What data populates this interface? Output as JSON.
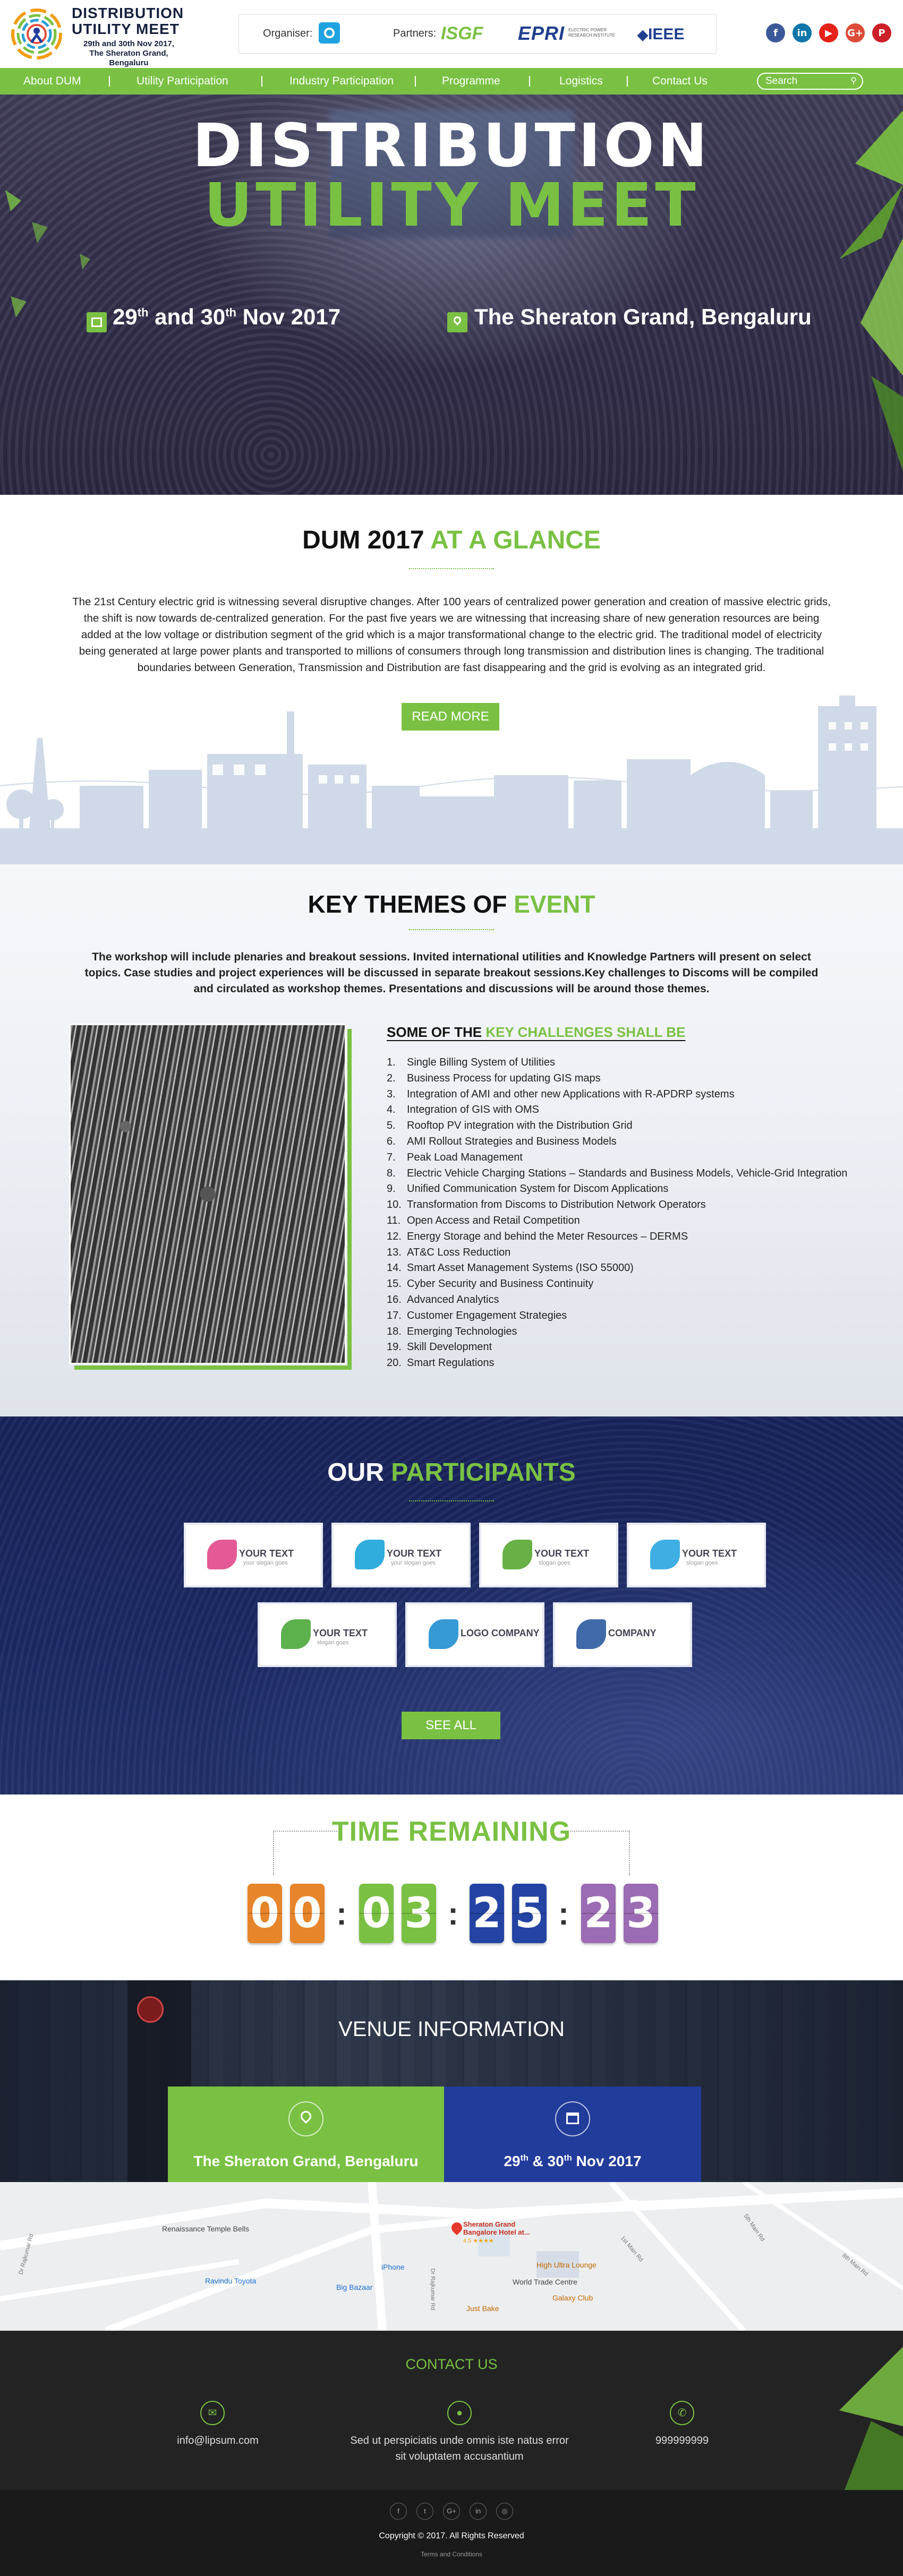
{
  "header": {
    "logo_title_1": "DISTRIBUTION",
    "logo_title_2": "UTILITY MEET",
    "logo_sub_1": "29th and 30th Nov 2017,",
    "logo_sub_2": "The Sheraton Grand, Bengaluru",
    "organiser_label": "Organiser:",
    "partners_label": "Partners:",
    "partner_isgf": "ISGF",
    "partner_epri": "EPRI",
    "partner_epri_sub": "ELECTRIC POWER RESEARCH INSTITUTE",
    "partner_ieee": "IEEE",
    "social": [
      {
        "name": "facebook-icon",
        "glyph": "f",
        "color": "#3b5998"
      },
      {
        "name": "linkedin-icon",
        "glyph": "in",
        "color": "#0e76a8"
      },
      {
        "name": "youtube-icon",
        "glyph": "▶",
        "color": "#e62117"
      },
      {
        "name": "googleplus-icon",
        "glyph": "G+",
        "color": "#dd4b39"
      },
      {
        "name": "pinterest-icon",
        "glyph": "P",
        "color": "#cb2027"
      }
    ]
  },
  "nav": {
    "items": [
      "About DUM",
      "Utility Participation",
      "Industry Participation",
      "Programme",
      "Logistics",
      "Contact Us"
    ],
    "search_placeholder": "Search"
  },
  "hero": {
    "title_1": "DISTRIBUTION",
    "title_2": "UTILITY MEET",
    "date_day1": "29",
    "date_sup1": "th",
    "date_and": " and 30",
    "date_sup2": "th",
    "date_tail": " Nov 2017",
    "venue": "The Sheraton Grand, Bengaluru"
  },
  "glance": {
    "title_a": "DUM 2017 ",
    "title_b": "AT A GLANCE",
    "paragraph": "The 21st Century electric grid is witnessing several disruptive changes. After 100 years of centralized power generation and creation of massive electric grids, the shift is now towards de-centralized generation. For the past five years we are witnessing that increasing share of new generation resources are being added at the low voltage or distribution segment of the grid which is a major transformational change to the electric grid. The traditional model of electricity being generated at large power plants and transported to millions of consumers through long transmission and distribution lines is changing. The traditional boundaries between Generation, Transmission and Distribution are fast disappearing and the grid is evolving as an integrated grid.",
    "button": "READ MORE"
  },
  "themes": {
    "title_a": "KEY THEMES OF ",
    "title_b": "EVENT",
    "paragraph": "The workshop will include plenaries and breakout sessions. Invited international utilities and Knowledge Partners will present on select topics. Case studies and project experiences will be discussed in separate breakout sessions.Key challenges to Discoms will be compiled and circulated as workshop themes. Presentations and discussions will be around those themes.",
    "kc_title_a": "SOME OF THE ",
    "kc_title_b": "KEY CHALLENGES SHALL BE",
    "challenges": [
      "Single Billing System of Utilities",
      "Business Process for updating GIS maps",
      "Integration of AMI and other new Applications with R-APDRP systems",
      "Integration of GIS with OMS",
      "Rooftop PV integration with the Distribution Grid",
      "AMI Rollout Strategies and Business Models",
      "Peak Load Management",
      "Electric Vehicle Charging Stations – Standards and Business Models, Vehicle-Grid Integration",
      "Unified Communication System for Discom Applications",
      "Transformation from Discoms to Distribution Network Operators",
      "Open Access and Retail Competition",
      "Energy Storage and behind the Meter Resources – DERMS",
      "AT&C Loss Reduction",
      "Smart Asset Management Systems (ISO 55000)",
      "Cyber Security and Business Continuity",
      "Advanced Analytics",
      "Customer Engagement Strategies",
      "Emerging Technologies",
      "Skill Development",
      "Smart Regulations"
    ]
  },
  "participants": {
    "title_a": "OUR ",
    "title_b": "PARTICIPANTS",
    "logos": [
      {
        "text": "YOUR TEXT",
        "sub": "your slogan goes",
        "color": "#e0488b"
      },
      {
        "text": "YOUR TEXT",
        "sub": "your slogan goes",
        "color": "#1aa3d9"
      },
      {
        "text": "YOUR TEXT",
        "sub": "slogan goes",
        "color": "#57a832"
      },
      {
        "text": "YOUR TEXT",
        "sub": "slogan goes",
        "color": "#2aa6e0"
      },
      {
        "text": "YOUR TEXT",
        "sub": "slogan goes",
        "color": "#4aa83a"
      },
      {
        "text": "LOGO COMPANY",
        "sub": "",
        "color": "#1f8fd0"
      },
      {
        "text": "COMPANY",
        "sub": "",
        "color": "#2c5aa0"
      }
    ],
    "button": "SEE ALL"
  },
  "timer": {
    "title": "TIME REMAINING",
    "digits": [
      "0",
      "0",
      "0",
      "3",
      "2",
      "5",
      "2",
      "3"
    ]
  },
  "venue": {
    "title": "VENUE INFORMATION",
    "place": "The Sheraton Grand, Bengaluru",
    "date_a": "29",
    "date_sup1": "th",
    "date_b": " & 30",
    "date_sup2": "th",
    "date_c": " Nov 2017",
    "map_labels": {
      "hotel": "Sheraton Grand Bangalore Hotel at...",
      "hotel_rating": "4.5 ★★★★",
      "renaissance": "Renaissance Temple Bells",
      "ravindu": "Ravindu Toyota",
      "bigbazaar": "Big Bazaar",
      "iphone": "iPhone",
      "hulltra": "High Ultra Lounge",
      "wtc": "World Trade Centre",
      "galaxy": "Galaxy Club",
      "justbake": "Just Bake",
      "road_1": "Dr Rajkumar Rd",
      "road_2": "5th Main Rd",
      "road_3": "1st Main Rd",
      "road_4": "8th Main Rd",
      "road_5": "Dr Rajkumar Rd"
    }
  },
  "footer": {
    "title": "CONTACT US",
    "email": "info@lipsum.com",
    "address_1": "Sed ut perspiciatis unde omnis iste natus error",
    "address_2": "sit voluptatem accusantium",
    "phone": "999999999",
    "social": [
      "f",
      "t",
      "G+",
      "in",
      "◎"
    ],
    "copyright": "Copyright © 2017. All Rights Reserved",
    "terms": "Terms and Conditions"
  }
}
